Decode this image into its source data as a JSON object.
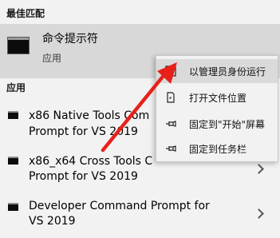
{
  "best_match": {
    "section_title": "最佳匹配",
    "name": "命令提示符",
    "type": "应用"
  },
  "apps": {
    "section_title": "应用",
    "items": [
      {
        "line1": "x86 Native Tools Com",
        "line2": "Prompt for VS 2019"
      },
      {
        "line1": "x86_x64 Cross Tools C",
        "line2": "Prompt for VS 2019"
      },
      {
        "line1": "Developer Command Prompt for",
        "line2": "VS 2019"
      }
    ]
  },
  "context_menu": {
    "items": [
      {
        "label": "以管理员身份运行",
        "icon": "shield-run-icon"
      },
      {
        "label": "打开文件位置",
        "icon": "file-location-icon"
      },
      {
        "label": "固定到\"开始\"屏幕",
        "icon": "pin-icon"
      },
      {
        "label": "固定到任务栏",
        "icon": "pin-icon"
      }
    ]
  },
  "colors": {
    "arrow": "#e8201a",
    "selected_bg": "#d8d8d8",
    "menu_hover_bg": "#dadada"
  }
}
